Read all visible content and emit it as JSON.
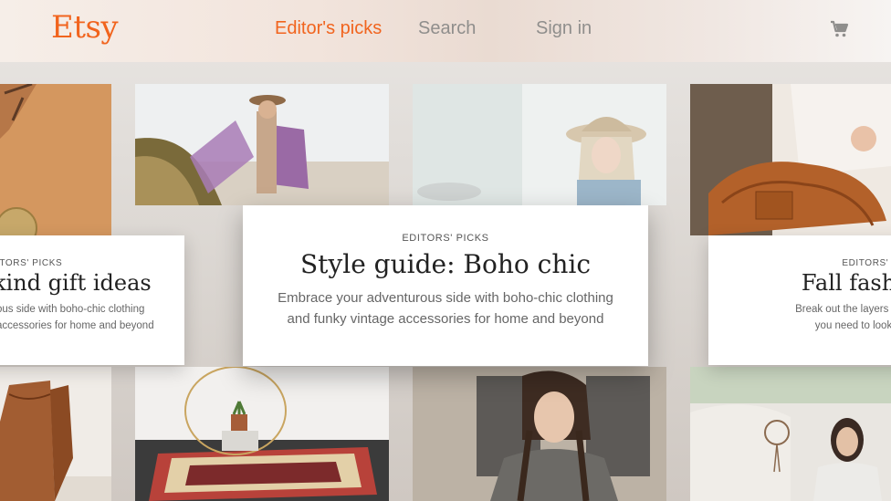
{
  "header": {
    "logo": "Etsy",
    "nav": {
      "editors_picks": "Editor's picks",
      "search": "Search",
      "sign_in": "Sign in"
    },
    "cart_icon": "shopping-cart-icon",
    "accent_color": "#f1641e"
  },
  "cards": {
    "left": {
      "eyebrow": "ITORS' PICKS",
      "title": "kind gift ideas",
      "desc_line1": "ous side with boho-chic clothing",
      "desc_line2": "accessories for home and beyond"
    },
    "focused": {
      "eyebrow": "EDITORS' PICKS",
      "title": "Style guide: Boho chic",
      "desc_line1": "Embrace your adventurous side with boho-chic clothing",
      "desc_line2": "and funky vintage accessories for home and beyond"
    },
    "right": {
      "eyebrow": "EDITORS' PICKS",
      "title": "Fall fashion ac",
      "desc_line1": "Break out the layers and pile on the c",
      "desc_line2": "you need to look chic (and st"
    }
  }
}
